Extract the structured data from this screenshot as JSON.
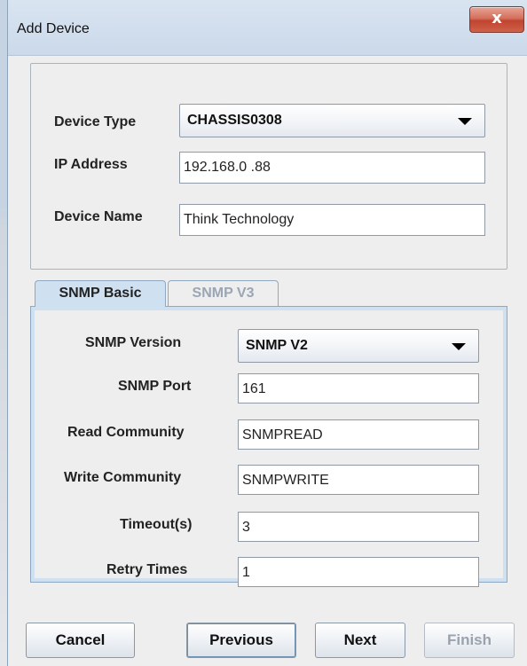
{
  "window": {
    "title": "Add Device",
    "close_glyph": "x"
  },
  "device": {
    "type_label": "Device Type",
    "type_value": "CHASSIS0308",
    "ip_label": "IP Address",
    "ip_value": "192.168.0  .88",
    "name_label": "Device Name",
    "name_value": "Think Technology"
  },
  "tabs": [
    {
      "label": "SNMP Basic",
      "active": true
    },
    {
      "label": "SNMP V3",
      "active": false
    }
  ],
  "snmp": {
    "version_label": "SNMP Version",
    "version_value": "SNMP V2",
    "port_label": "SNMP Port",
    "port_value": "161",
    "read_label": "Read Community",
    "read_value": "SNMPREAD",
    "write_label": "Write Community",
    "write_value": "SNMPWRITE",
    "timeout_label": "Timeout(s)",
    "timeout_value": "3",
    "retry_label": "Retry Times",
    "retry_value": "1"
  },
  "buttons": {
    "cancel": "Cancel",
    "previous": "Previous",
    "next": "Next",
    "finish": "Finish"
  },
  "colors": {
    "tab_panel": "#cfe0f1",
    "close_button": "#c0442f"
  }
}
